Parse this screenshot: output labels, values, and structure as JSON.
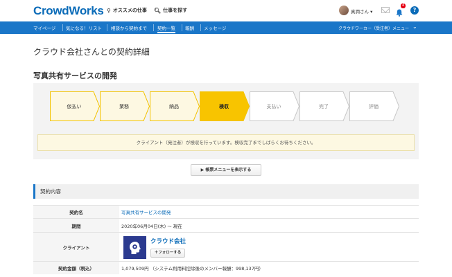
{
  "header": {
    "logo": "CrowdWorks",
    "recommended_jobs": "オススメの仕事",
    "find_jobs": "仕事を探す",
    "username": "真潤さん ▾",
    "notification_count": "4",
    "help": "?"
  },
  "nav": {
    "items": [
      {
        "label": "マイページ"
      },
      {
        "label": "気になる！リスト"
      },
      {
        "label": "相談から契約まで"
      },
      {
        "label": "契約一覧"
      },
      {
        "label": "報酬"
      },
      {
        "label": "メッセージ"
      }
    ],
    "active_index": 3,
    "role_menu": "クラウドワーカー（受注者）メニュー"
  },
  "page": {
    "title": "クラウド会社さんとの契約詳細",
    "project_title": "写真共有サービスの開発"
  },
  "progress": {
    "steps": [
      {
        "label": "仮払い",
        "state": "done"
      },
      {
        "label": "業務",
        "state": "done"
      },
      {
        "label": "納品",
        "state": "done"
      },
      {
        "label": "検収",
        "state": "current"
      },
      {
        "label": "支払い",
        "state": "todo"
      },
      {
        "label": "完了",
        "state": "todo"
      },
      {
        "label": "評価",
        "state": "todo"
      }
    ],
    "notice": "クライアント（発注者）が検収を行っています。検収完了までしばらくお待ちください。"
  },
  "menu_button": "▶ 帳票メニューを表示する",
  "section": {
    "title": "契約内容"
  },
  "contract": {
    "name_label": "契約名",
    "name_value": "写真共有サービスの開発",
    "period_label": "期間",
    "period_value": "2020年06月04日(木) 〜 現在",
    "client_label": "クライアント",
    "client_name": "クラウド会社",
    "follow_button": "＋フォローする",
    "amount_label": "契約金額（税込）",
    "amount_value": "1,079,509円 （システム利用料控除後のメンバー報酬：998,137円）"
  },
  "colors": {
    "brand": "#0a6bb8",
    "nav_bg": "#1a76c8",
    "step_done_fill": "#fdf8e2",
    "step_done_border": "#f3c300",
    "step_current_fill": "#f8c400",
    "step_todo_border": "#c8c8c8",
    "notification_badge": "#e60012"
  }
}
